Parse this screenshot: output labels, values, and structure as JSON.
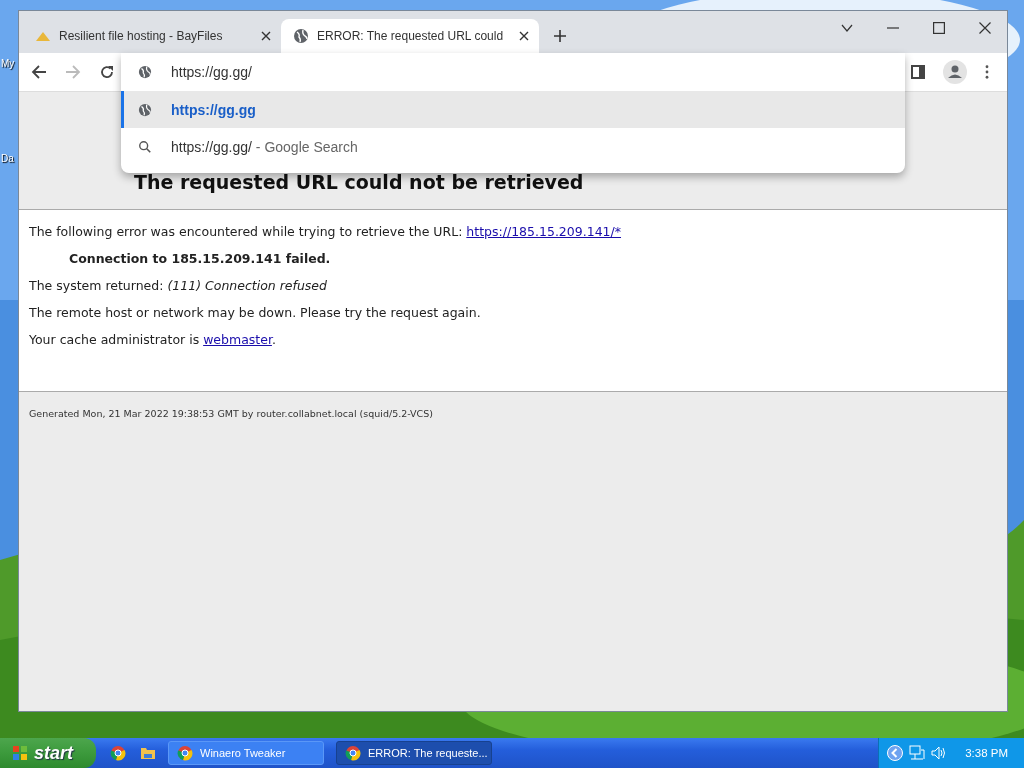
{
  "desktop": {
    "icon_labels": [
      "My",
      "Da"
    ]
  },
  "browser": {
    "tabs": [
      {
        "title": "Resilient file hosting - BayFiles",
        "kind": "bayfiles",
        "selected": false
      },
      {
        "title": "ERROR: The requested URL could",
        "kind": "globe",
        "selected": true
      }
    ],
    "forward_disabled": true,
    "address": {
      "value": "https://gg.gg/"
    },
    "suggestions": [
      {
        "kind": "url",
        "text": "https://gg.gg",
        "selected": true
      },
      {
        "kind": "search",
        "text": "https://gg.gg/",
        "suffix": " - Google Search",
        "selected": false
      }
    ]
  },
  "page": {
    "heading": "The requested URL could not be retrieved",
    "intro": "The following error was encountered while trying to retrieve the URL: ",
    "intro_link": "https://185.15.209.141/*",
    "error": "Connection to 185.15.209.141 failed.",
    "system_returned": "The system returned: *(111) Connection refused*",
    "advice": "The remote host or network may be down. Please try the request again.",
    "admin_text": "Your cache administrator is ",
    "admin_link": "webmaster",
    "admin_end": ".",
    "footer": "Generated Mon, 21 Mar 2022 19:38:53 GMT by router.collabnet.local (squid/5.2-VCS)"
  },
  "taskbar": {
    "start": "start",
    "tasks": [
      {
        "title": "Winaero Tweaker",
        "selected": false
      },
      {
        "title": "ERROR: The requeste...",
        "selected": true
      }
    ],
    "clock": "3:38 PM"
  }
}
